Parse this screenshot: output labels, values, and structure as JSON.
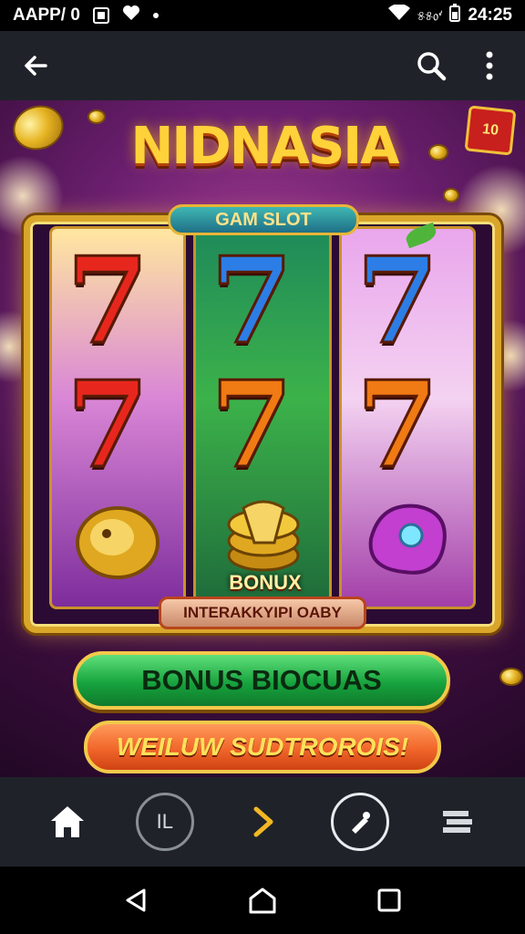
{
  "status_bar": {
    "app_label": "AAPP/ 0",
    "indicator_text": "୫୫᥆ᔊ",
    "time": "24:25"
  },
  "app_bar": {
    "back_icon": "arrow-left-icon",
    "search_icon": "search-icon",
    "more_icon": "more-vert-icon"
  },
  "banner": {
    "title": "NIDNASIA",
    "badge": "10",
    "reel_label": "GAM SLOT",
    "bonus_word": "BONUX",
    "bonus_ribbon": "INTERAKKYIPI OABY",
    "reels": [
      {
        "top": "7",
        "middle": "7",
        "bottom": "coin-symbol"
      },
      {
        "top": "7",
        "middle": "7",
        "bottom": "coin-stack-symbol"
      },
      {
        "top": "7",
        "middle": "7",
        "bottom": "gem-shell-symbol"
      }
    ],
    "primary_button": "BONUS BIOCUAS",
    "secondary_button": "WEILUW SUDTROROIS!"
  },
  "bottom_nav": {
    "items": [
      {
        "icon": "home-icon"
      },
      {
        "icon": "library-icon",
        "label": "IL"
      },
      {
        "icon": "chevron-right-icon"
      },
      {
        "icon": "edit-icon"
      },
      {
        "icon": "menu-icon"
      }
    ]
  },
  "system_nav": {
    "back": "triangle-back-icon",
    "home": "home-outline-icon",
    "recents": "square-recents-icon"
  },
  "colors": {
    "app_bar": "#1f2329",
    "gold": "#d9a62a",
    "accent_yellow": "#f2b824"
  }
}
